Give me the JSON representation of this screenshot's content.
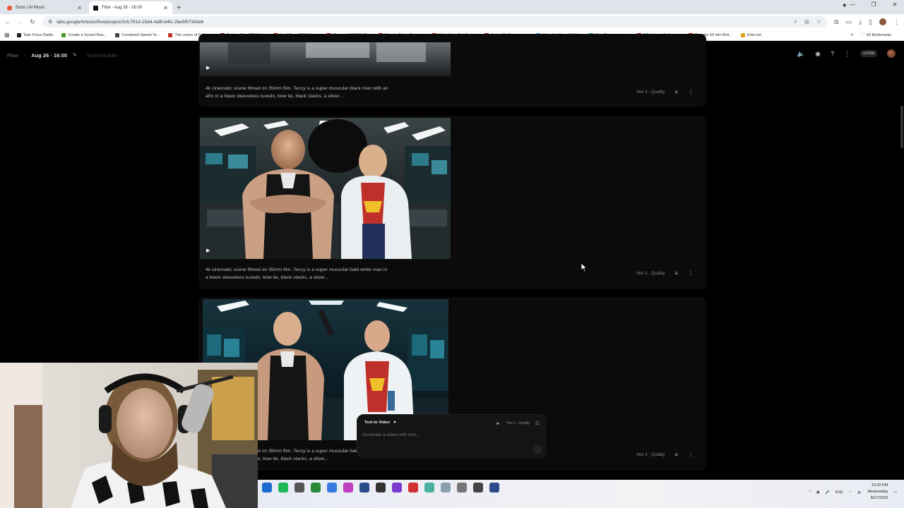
{
  "browser": {
    "tabs": [
      {
        "label": "Suno | AI Music",
        "active": false,
        "color": "#e8562a"
      },
      {
        "label": "Flow - Aug 26 - 16:00",
        "active": true,
        "color": "#111111"
      }
    ],
    "new_tab": "+",
    "url": "labs.google/fx/tools/flow/project/2cfc781d-25d4-4af8-b4fc-2be5f57343e6",
    "bookmarks": [
      {
        "label": "Task Force Radio",
        "color": "#222222"
      },
      {
        "label": "Create a Sound Rea...",
        "color": "#4a9a2a"
      },
      {
        "label": "Combined Speed Te...",
        "color": "#444444"
      },
      {
        "label": "The colors of Defqo...",
        "color": "#c0392b"
      },
      {
        "label": "Defqon One 2013 H...",
        "color": "#cc0000"
      },
      {
        "label": "Hard Bass 2013 (Liv...",
        "color": "#cc0000"
      },
      {
        "label": "Mixmag | WATCH D...",
        "color": "#cc0000"
      },
      {
        "label": "Electric Daisy Carniv...",
        "color": "#cc0000"
      },
      {
        "label": "Make Your Car Fast...",
        "color": "#cc0000"
      },
      {
        "label": "Just a Bit Fortress -...",
        "color": "#cc0000"
      },
      {
        "label": "Mixed In Key - DJ S...",
        "color": "#2a9ad0"
      },
      {
        "label": "Star Citizen - Imgur",
        "color": "#2a9a6a"
      },
      {
        "label": "Villalobos - Fizheue...",
        "color": "#cc0000"
      },
      {
        "label": "Bonobo 50 min Boil...",
        "color": "#cc0000"
      },
      {
        "label": "Kritz.net",
        "color": "#e0a020"
      }
    ],
    "all_bookmarks": "All Bookmarks"
  },
  "app": {
    "breadcrumb_root": "Flow",
    "project_title": "Aug 26 - 16:00",
    "view_label": "Scenebuilder",
    "plan_badge": "ULTRA"
  },
  "cards": [
    {
      "prompt": "4k cinematic scene filmed on 35mm film. Teccy is a super muscular black man with an afro in a black sleeveless tuxedo, bow tie, black slacks, a silver...",
      "model": "Veo 3 - Quality"
    },
    {
      "prompt": "4k cinematic scene filmed on 35mm film. Teccy is a super muscular bald white man in a black sleeveless tuxedo, bow tie, black slacks, a silver...",
      "model": "Veo 3 - Quality"
    },
    {
      "prompt": "4k cinematic scene filmed on 35mm film. Teccy is a super muscular bald white man in a black sleeveless tuxedo, bow tie, black slacks, a silver...",
      "model": "Veo 3 - Quality"
    }
  ],
  "composer": {
    "mode": "Text to Video",
    "model": "Veo 3 - Quality",
    "placeholder": "Generate a video with text..."
  },
  "taskbar": {
    "lang": "ENG",
    "time": "10:20 PM",
    "day": "Wednesday",
    "date": "8/27/2025",
    "app_colors": [
      "#1a6ad0",
      "#1db954",
      "#555555",
      "#2a8a3a",
      "#3a7ae0",
      "#c040c0",
      "#2a4a8a",
      "#333333",
      "#7a3ad0",
      "#d03030",
      "#4ab0a0",
      "#8aa0b0",
      "#777777",
      "#444444",
      "#2a4a8a"
    ]
  }
}
